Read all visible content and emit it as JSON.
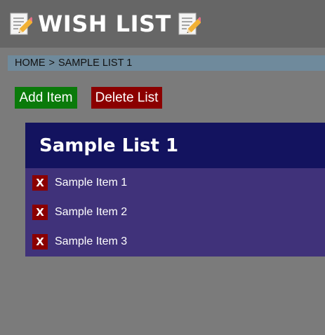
{
  "header": {
    "title": "WISH LIST",
    "left_icon": "memo-icon",
    "right_icon": "memo-icon"
  },
  "breadcrumb": {
    "home": "HOME",
    "separator": ">",
    "current": "SAMPLE LIST 1"
  },
  "toolbar": {
    "add_label": "Add Item",
    "delete_label": "Delete List"
  },
  "list": {
    "title": "Sample List 1",
    "items": [
      {
        "label": "Sample Item 1",
        "delete": "X"
      },
      {
        "label": "Sample Item 2",
        "delete": "X"
      },
      {
        "label": "Sample Item 3",
        "delete": "X"
      }
    ]
  },
  "colors": {
    "page_background": "#7b7b7b",
    "header_background": "#666666",
    "breadcrumb_background": "#6f8a9c",
    "add_button": "#0a7a0a",
    "delete_button": "#8b0000",
    "list_header": "#13135f",
    "list_body": "#40327a"
  }
}
